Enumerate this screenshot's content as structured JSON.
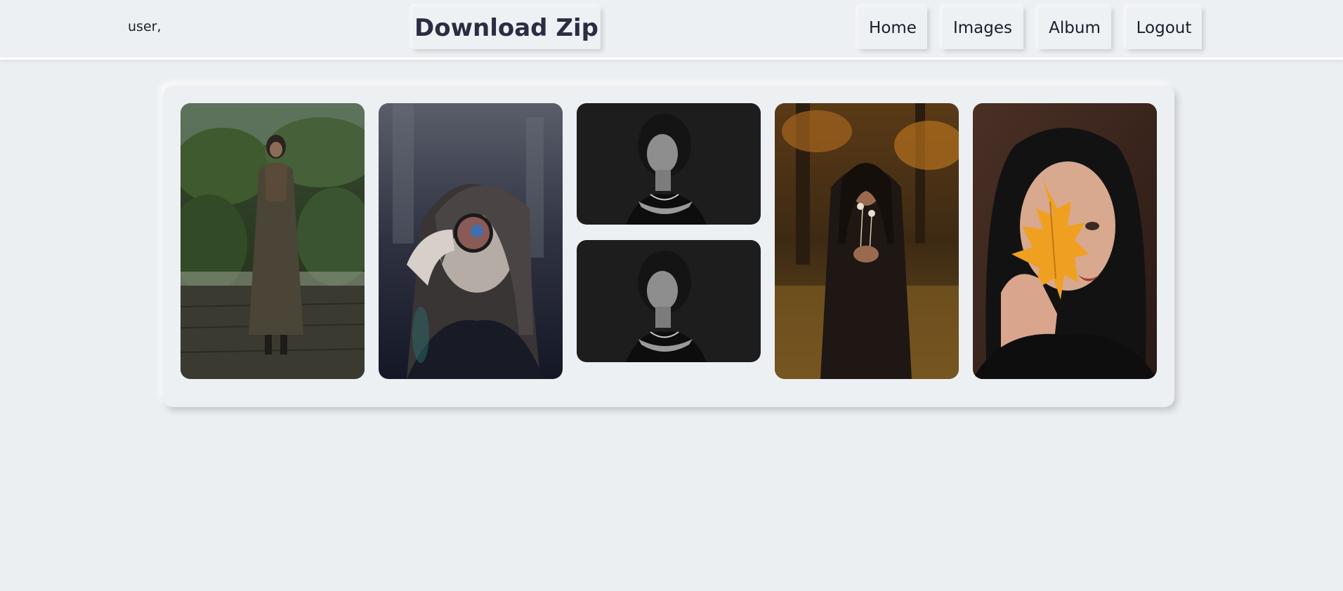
{
  "header": {
    "username": "user,",
    "download_label": "Download Zip",
    "nav": [
      {
        "label": "Home"
      },
      {
        "label": "Images"
      },
      {
        "label": "Album"
      },
      {
        "label": "Logout"
      }
    ]
  },
  "colors": {
    "background": "#eceff2",
    "text": "#2b2d42",
    "button_bg": "#eef1f4"
  },
  "gallery": {
    "images": [
      {
        "name": "woman-hijab-garden-photo"
      },
      {
        "name": "woman-lens-filter-photo"
      },
      {
        "name": "woman-dark-portrait-photo-1"
      },
      {
        "name": "woman-dark-portrait-photo-2"
      },
      {
        "name": "woman-dandelion-forest-photo"
      },
      {
        "name": "woman-autumn-leaf-photo"
      }
    ]
  }
}
